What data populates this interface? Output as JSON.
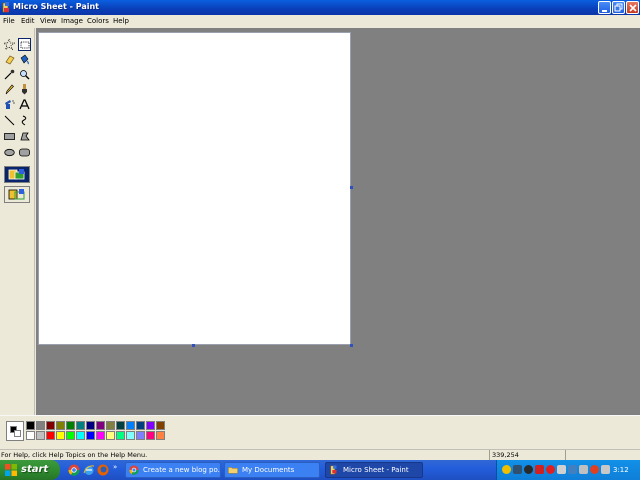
{
  "window": {
    "title": "Micro Sheet - Paint",
    "controls": [
      "minimize",
      "maximize",
      "close"
    ]
  },
  "menu": [
    "File",
    "Edit",
    "View",
    "Image",
    "Colors",
    "Help"
  ],
  "tools": [
    {
      "name": "free-form-select",
      "icon": "star-select-icon"
    },
    {
      "name": "select",
      "icon": "rect-select-icon",
      "active": true
    },
    {
      "name": "eraser",
      "icon": "eraser-icon"
    },
    {
      "name": "fill",
      "icon": "paint-bucket-icon"
    },
    {
      "name": "pick-color",
      "icon": "eyedropper-icon"
    },
    {
      "name": "magnifier",
      "icon": "magnifier-icon"
    },
    {
      "name": "pencil",
      "icon": "pencil-icon"
    },
    {
      "name": "brush",
      "icon": "brush-icon"
    },
    {
      "name": "airbrush",
      "icon": "airbrush-icon"
    },
    {
      "name": "text",
      "icon": "text-icon"
    },
    {
      "name": "line",
      "icon": "line-icon"
    },
    {
      "name": "curve",
      "icon": "curve-icon"
    },
    {
      "name": "rectangle",
      "icon": "rectangle-icon"
    },
    {
      "name": "polygon",
      "icon": "polygon-icon"
    },
    {
      "name": "ellipse",
      "icon": "ellipse-icon"
    },
    {
      "name": "rounded-rectangle",
      "icon": "rounded-rect-icon"
    }
  ],
  "palette": {
    "foreground": "#000000",
    "background": "#ffffff",
    "row1": [
      "#000000",
      "#808080",
      "#800000",
      "#808000",
      "#008000",
      "#008080",
      "#000080",
      "#800080",
      "#808040",
      "#004040",
      "#0080ff",
      "#004080",
      "#8000ff",
      "#804000"
    ],
    "row2": [
      "#ffffff",
      "#c0c0c0",
      "#ff0000",
      "#ffff00",
      "#00ff00",
      "#00ffff",
      "#0000ff",
      "#ff00ff",
      "#ffff80",
      "#00ff80",
      "#80ffff",
      "#8080ff",
      "#ff0080",
      "#ff8040"
    ]
  },
  "status": {
    "help_text": "For Help, click Help Topics on the Help Menu.",
    "coords": "339,254"
  },
  "taskbar": {
    "start_label": "start",
    "tasks": [
      {
        "label": "Create a new blog po...",
        "icon": "chrome-icon"
      },
      {
        "label": "My Documents",
        "icon": "folder-icon"
      },
      {
        "label": "Micro Sheet - Paint",
        "icon": "paint-icon",
        "active": true
      }
    ],
    "clock": "3:12 PM"
  }
}
